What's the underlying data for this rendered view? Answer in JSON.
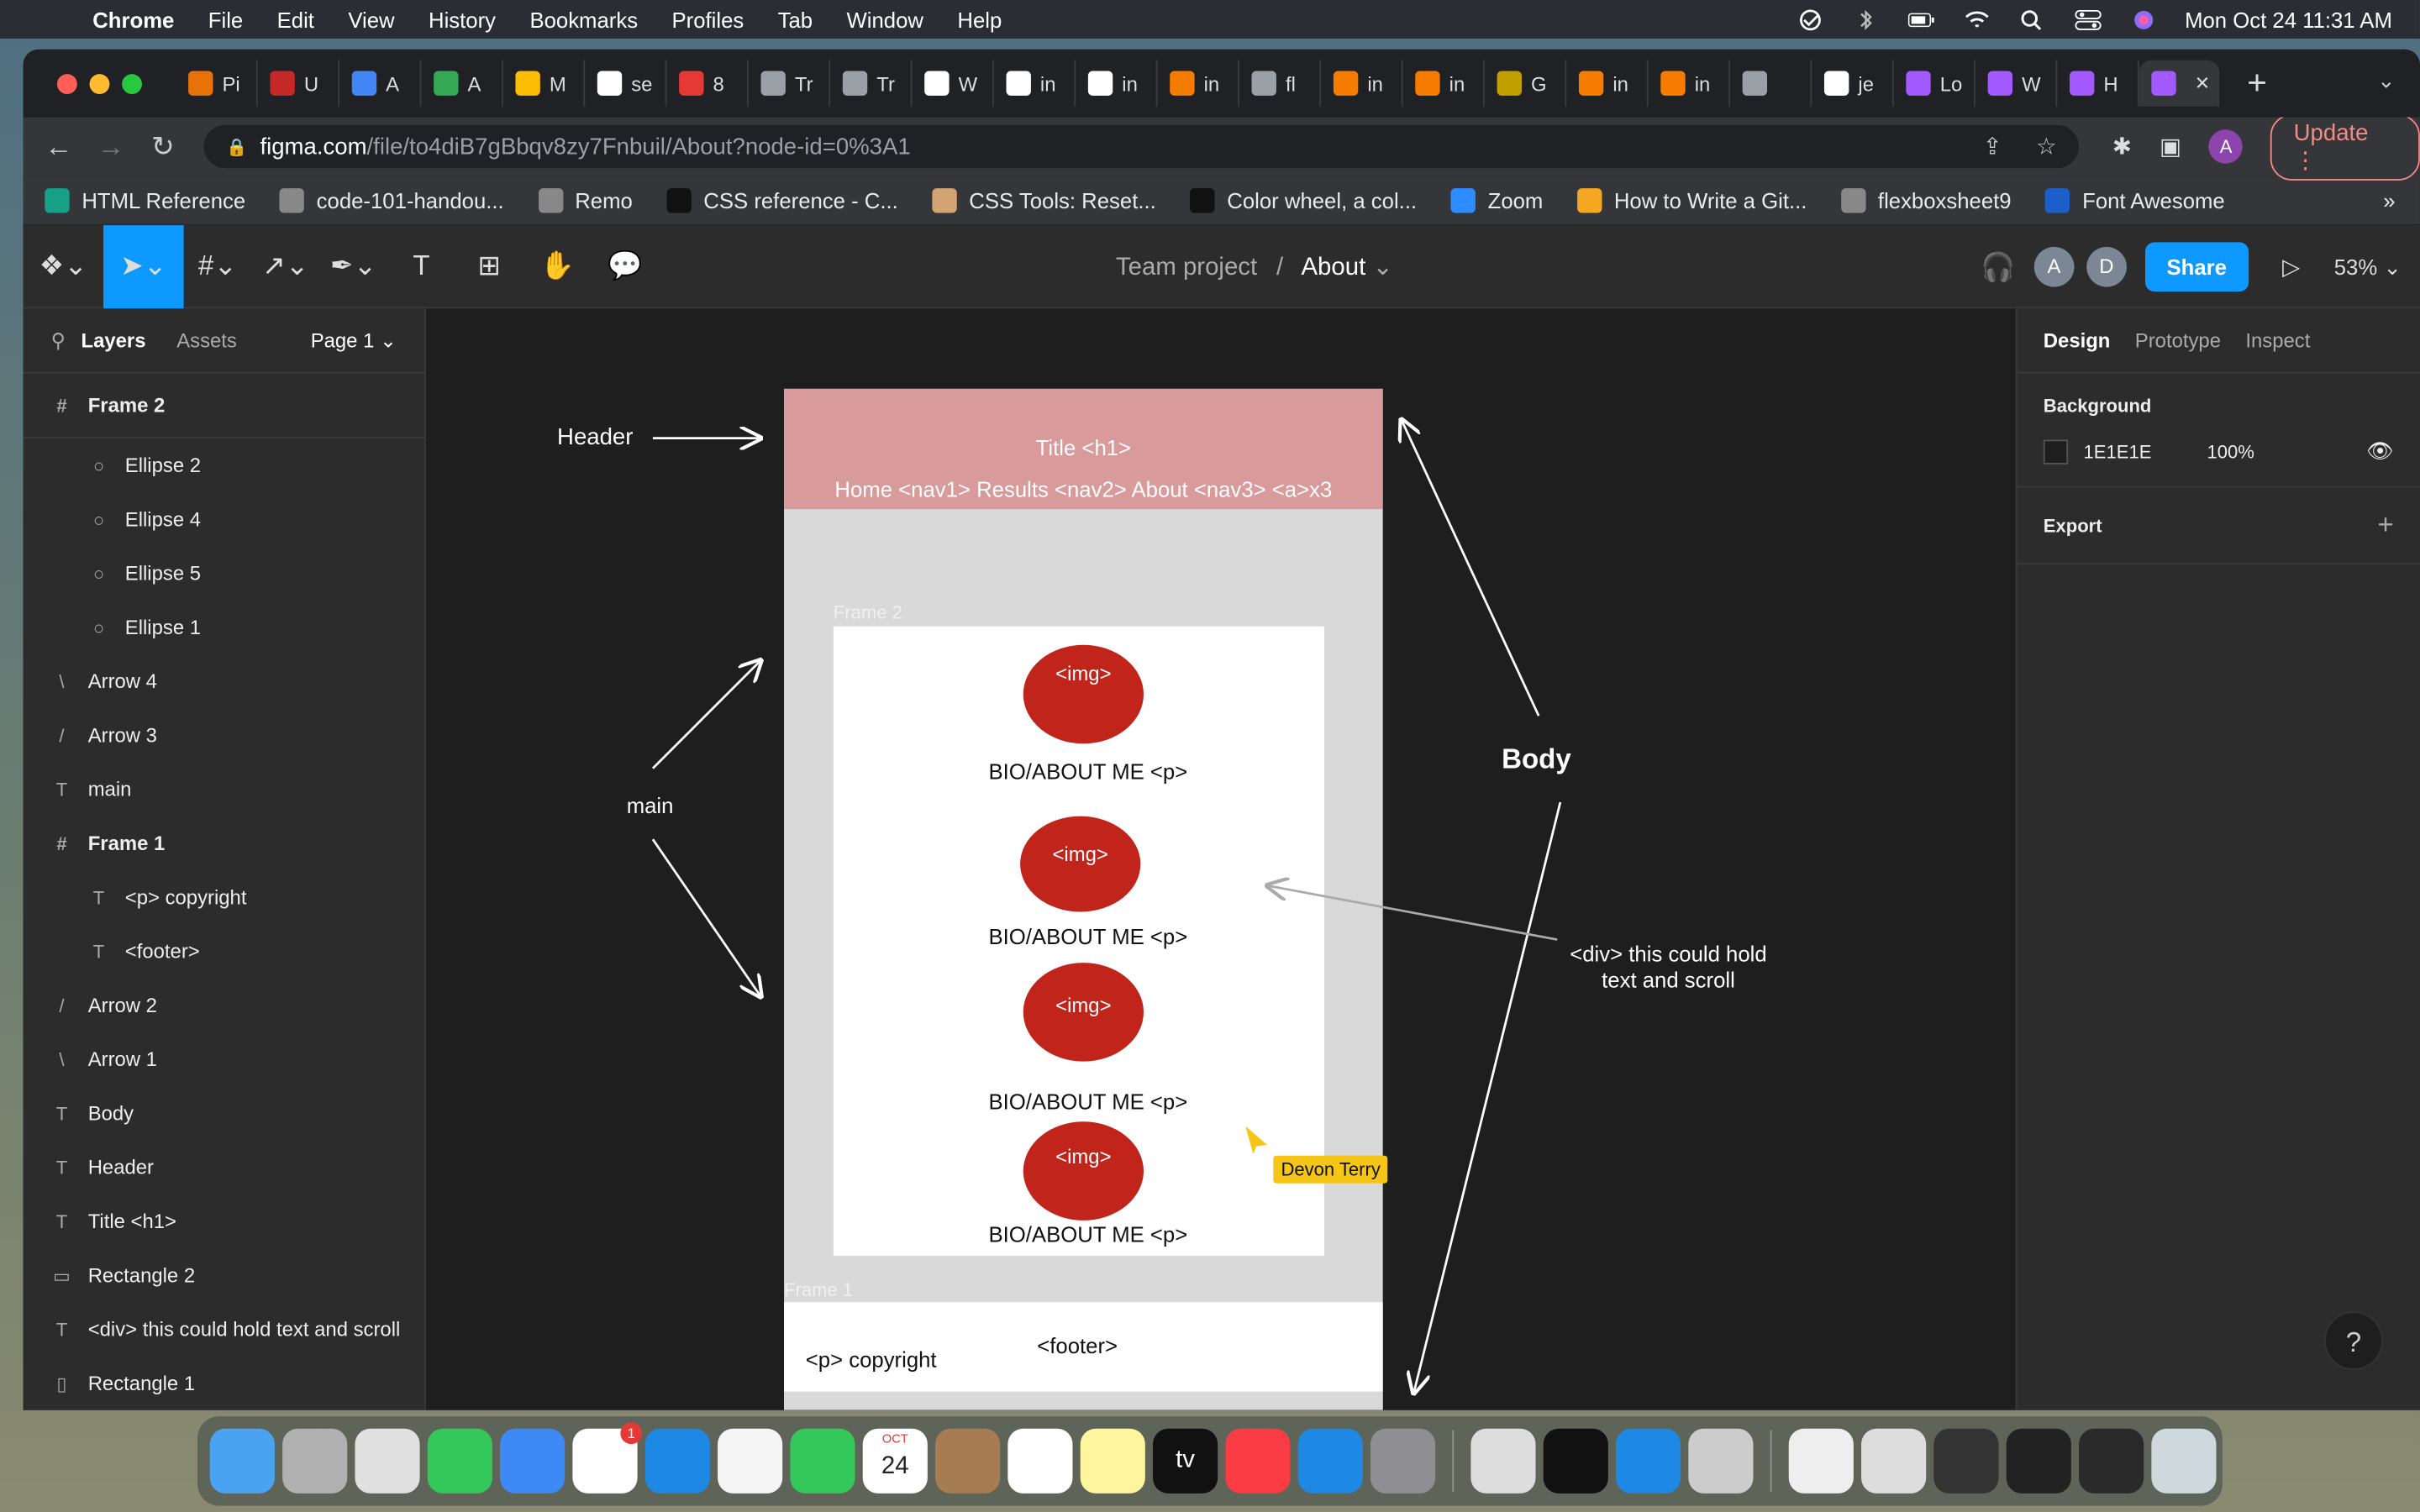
{
  "menubar": {
    "app": "Chrome",
    "items": [
      "File",
      "Edit",
      "View",
      "History",
      "Bookmarks",
      "Profiles",
      "Tab",
      "Window",
      "Help"
    ],
    "clock": "Mon Oct 24  11:31 AM"
  },
  "tabs": [
    {
      "label": "Pi",
      "color": "#e8710a"
    },
    {
      "label": "U",
      "color": "#c62828"
    },
    {
      "label": "A",
      "color": "#4285f4"
    },
    {
      "label": "A",
      "color": "#34a853"
    },
    {
      "label": "M",
      "color": "#fbbc04"
    },
    {
      "label": "se",
      "color": "#ffffff"
    },
    {
      "label": "8",
      "color": "#e53935"
    },
    {
      "label": "Tr",
      "color": "#9aa0a6"
    },
    {
      "label": "Tr",
      "color": "#9aa0a6"
    },
    {
      "label": "W",
      "color": "#ffffff"
    },
    {
      "label": "in",
      "color": "#ffffff"
    },
    {
      "label": "in",
      "color": "#ffffff"
    },
    {
      "label": "in",
      "color": "#f57c00"
    },
    {
      "label": "fl",
      "color": "#9aa0a6"
    },
    {
      "label": "in",
      "color": "#f57c00"
    },
    {
      "label": "in",
      "color": "#f57c00"
    },
    {
      "label": "G",
      "color": "#c0a000"
    },
    {
      "label": "in",
      "color": "#f57c00"
    },
    {
      "label": "in",
      "color": "#f57c00"
    },
    {
      "label": "",
      "color": "#9aa0a6"
    },
    {
      "label": "je",
      "color": "#ffffff"
    },
    {
      "label": "Lo",
      "color": "#a259ff"
    },
    {
      "label": "W",
      "color": "#a259ff"
    },
    {
      "label": "H",
      "color": "#a259ff"
    },
    {
      "label": "",
      "color": "#a259ff"
    }
  ],
  "address": {
    "host": "figma.com",
    "path": "/file/to4diB7gBbqv8zy7Fnbuil/About?node-id=0%3A1"
  },
  "toolbar": {
    "update_label": "Update",
    "profile_initial": "A"
  },
  "bookmarks": [
    {
      "label": "HTML Reference",
      "color": "#16a085"
    },
    {
      "label": "code-101-handou...",
      "color": "#888888"
    },
    {
      "label": "Remo",
      "color": "#888888"
    },
    {
      "label": "CSS reference - C...",
      "color": "#111111"
    },
    {
      "label": "CSS Tools: Reset...",
      "color": "#d4a373"
    },
    {
      "label": "Color wheel, a col...",
      "color": "#111111"
    },
    {
      "label": "Zoom",
      "color": "#2d8cff"
    },
    {
      "label": "How to Write a Git...",
      "color": "#f5a623"
    },
    {
      "label": "flexboxsheet9",
      "color": "#888888"
    },
    {
      "label": "Font Awesome",
      "color": "#1c5fc9"
    }
  ],
  "figma": {
    "breadcrumb_project": "Team project",
    "breadcrumb_sep": "/",
    "page_name": "About",
    "avatars": [
      "A",
      "D"
    ],
    "share_label": "Share",
    "zoom": "53%"
  },
  "layers_panel": {
    "tab_layers": "Layers",
    "tab_assets": "Assets",
    "page_select": "Page 1",
    "items": [
      {
        "label": "Frame 2",
        "icon": "#",
        "indent": 0,
        "frame": true
      },
      {
        "label": "Ellipse 2",
        "icon": "○",
        "indent": 1,
        "frame": false
      },
      {
        "label": "Ellipse 4",
        "icon": "○",
        "indent": 1,
        "frame": false
      },
      {
        "label": "Ellipse 5",
        "icon": "○",
        "indent": 1,
        "frame": false
      },
      {
        "label": "Ellipse 1",
        "icon": "○",
        "indent": 1,
        "frame": false
      },
      {
        "label": "Arrow 4",
        "icon": "\\",
        "indent": 0,
        "frame": false
      },
      {
        "label": "Arrow 3",
        "icon": "/",
        "indent": 0,
        "frame": false
      },
      {
        "label": "main",
        "icon": "T",
        "indent": 0,
        "frame": false
      },
      {
        "label": "Frame 1",
        "icon": "#",
        "indent": 0,
        "frame": true
      },
      {
        "label": "<p> copyright",
        "icon": "T",
        "indent": 1,
        "frame": false
      },
      {
        "label": "<footer>",
        "icon": "T",
        "indent": 1,
        "frame": false
      },
      {
        "label": "Arrow 2",
        "icon": "/",
        "indent": 0,
        "frame": false
      },
      {
        "label": "Arrow 1",
        "icon": "\\",
        "indent": 0,
        "frame": false
      },
      {
        "label": "Body",
        "icon": "T",
        "indent": 0,
        "frame": false
      },
      {
        "label": "Header",
        "icon": "T",
        "indent": 0,
        "frame": false
      },
      {
        "label": "Title <h1>",
        "icon": "T",
        "indent": 0,
        "frame": false
      },
      {
        "label": "Rectangle 2",
        "icon": "▭",
        "indent": 0,
        "frame": false
      },
      {
        "label": "<div> this could hold text and scroll",
        "icon": "T",
        "indent": 0,
        "frame": false
      },
      {
        "label": "Rectangle 1",
        "icon": "▯",
        "indent": 0,
        "frame": false
      }
    ]
  },
  "canvas": {
    "header_label": "Header",
    "main_label": "main",
    "body_label": "Body",
    "title_text": "Title <h1>",
    "nav_text": "Home <nav1> Results <nav2> About <nav3> <a>x3",
    "frame2_label": "Frame 2",
    "frame1_label": "Frame 1",
    "img_label": "<img>",
    "bio_label": "BIO/ABOUT ME <p>",
    "div_note": "<div> this could hold\ntext and scroll",
    "cursor_user": "Devon Terry",
    "copyright": "<p> copyright",
    "footer": "<footer>",
    "colors": {
      "header": "#d89a9a",
      "ellipse": "#c0241a",
      "main_bg": "#d9d9d9",
      "cursor": "#f5c518"
    }
  },
  "design_panel": {
    "tab_design": "Design",
    "tab_prototype": "Prototype",
    "tab_inspect": "Inspect",
    "background_heading": "Background",
    "bg_hex": "1E1E1E",
    "bg_opacity": "100%",
    "export_heading": "Export",
    "help": "?"
  },
  "dock": {
    "apps": [
      {
        "name": "finder",
        "color": "#4aa3f0"
      },
      {
        "name": "launchpad",
        "color": "#b0b0b0"
      },
      {
        "name": "chrome",
        "color": "#e0e0e0"
      },
      {
        "name": "messages",
        "color": "#34c759"
      },
      {
        "name": "mail",
        "color": "#3d8af7"
      },
      {
        "name": "slack",
        "color": "#ffffff",
        "badge": "1"
      },
      {
        "name": "xcode",
        "color": "#1e88e5"
      },
      {
        "name": "photos",
        "color": "#f5f5f5"
      },
      {
        "name": "facetime",
        "color": "#34c759"
      },
      {
        "name": "calendar",
        "color": "#ffffff",
        "text": "24"
      },
      {
        "name": "contacts",
        "color": "#a67c52"
      },
      {
        "name": "reminders",
        "color": "#ffffff"
      },
      {
        "name": "notes",
        "color": "#fff59d"
      },
      {
        "name": "tv",
        "color": "#111111",
        "text": "tv"
      },
      {
        "name": "music",
        "color": "#fc3c44"
      },
      {
        "name": "app-store",
        "color": "#1e88e5"
      },
      {
        "name": "system-preferences",
        "color": "#8e8e93"
      },
      {
        "name": "vpn",
        "color": "#dddddd"
      },
      {
        "name": "terminal",
        "color": "#111111"
      },
      {
        "name": "vscode",
        "color": "#1e88e5"
      },
      {
        "name": "preview",
        "color": "#cccccc"
      },
      {
        "name": "doc-1",
        "color": "#eeeeee"
      },
      {
        "name": "doc-2",
        "color": "#dddddd"
      },
      {
        "name": "doc-3",
        "color": "#333333"
      },
      {
        "name": "doc-4",
        "color": "#222222"
      },
      {
        "name": "doc-5",
        "color": "#2a2a2a"
      },
      {
        "name": "trash",
        "color": "#cfd8dc"
      }
    ],
    "calendar_month": "OCT"
  }
}
